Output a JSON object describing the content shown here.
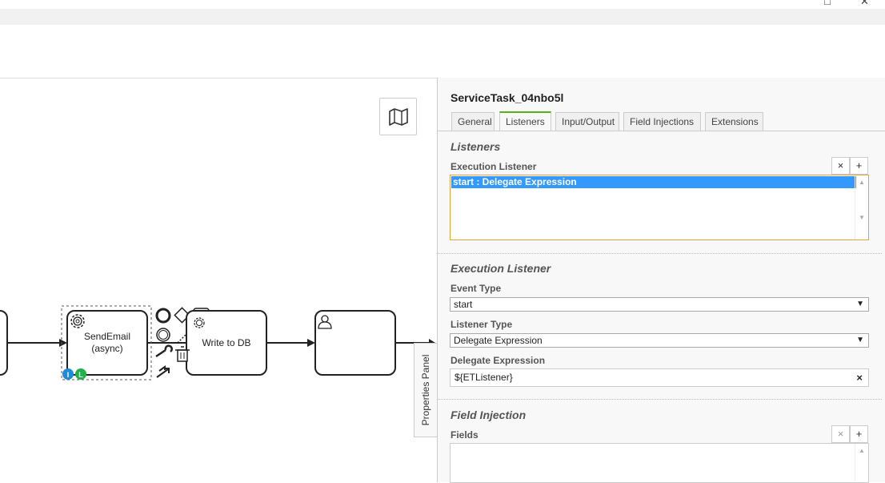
{
  "window": {
    "restore_icon": "restore-icon",
    "close_icon": "close-icon"
  },
  "canvas": {
    "minimap_icon": "map-icon",
    "tasks": {
      "send_email": "SendEmail\n(async)",
      "write_db": "Write to DB"
    },
    "badges": {
      "input_badge": "I",
      "listener_badge": "L"
    },
    "properties_tab": "Properties Panel"
  },
  "panel": {
    "title": "ServiceTask_04nbo5l",
    "tabs": [
      {
        "label": "General"
      },
      {
        "label": "Listeners"
      },
      {
        "label": "Input/Output"
      },
      {
        "label": "Field Injections"
      },
      {
        "label": "Extensions"
      }
    ],
    "active_tab": "Listeners",
    "listeners_group": {
      "title": "Listeners",
      "execution_listener_label": "Execution Listener",
      "remove_label": "×",
      "add_label": "+",
      "items": [
        "start : Delegate Expression"
      ]
    },
    "execution_listener_group": {
      "title": "Execution Listener",
      "event_type_label": "Event Type",
      "event_type_value": "start",
      "listener_type_label": "Listener Type",
      "listener_type_value": "Delegate Expression",
      "delegate_expression_label": "Delegate Expression",
      "delegate_expression_value": "${ETListener}",
      "clear_label": "×"
    },
    "field_injection_group": {
      "title": "Field Injection",
      "fields_label": "Fields",
      "remove_label": "×",
      "add_label": "+"
    }
  },
  "colors": {
    "accent_green": "#52b415",
    "selection_blue": "#3399ff",
    "focus_orange": "#e8a23b"
  }
}
